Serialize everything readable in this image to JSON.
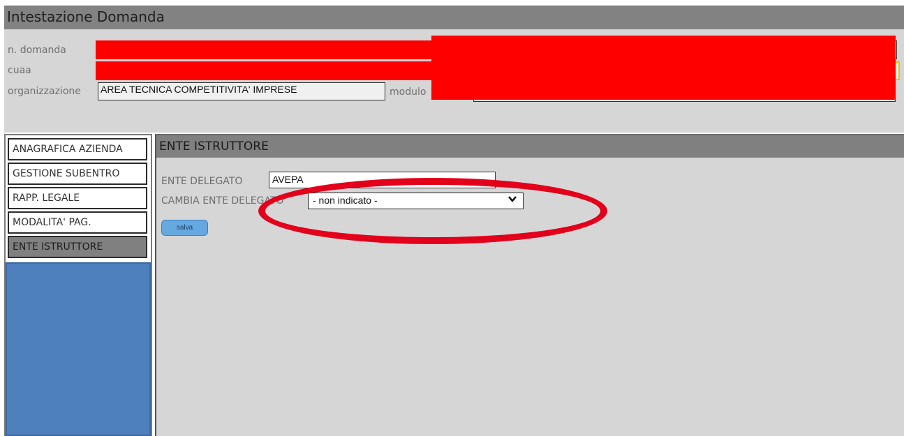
{
  "header": {
    "title": "Intestazione Domanda"
  },
  "info": {
    "n_domanda_label": "n. domanda",
    "cuaa_label": "cuaa",
    "organizzazione_label": "organizzazione",
    "organizzazione_value": "AREA TECNICA COMPETITIVITA' IMPRESE",
    "modulo_label": "modulo"
  },
  "nav": {
    "items": [
      {
        "label": "ANAGRAFICA AZIENDA"
      },
      {
        "label": "GESTIONE SUBENTRO"
      },
      {
        "label": "RAPP. LEGALE"
      },
      {
        "label": "MODALITA' PAG."
      },
      {
        "label": "ENTE ISTRUTTORE"
      }
    ],
    "active_index": 4
  },
  "main": {
    "title": "ENTE ISTRUTTORE",
    "ente_delegato_label": "ENTE DELEGATO",
    "ente_delegato_value": "AVEPA",
    "cambia_label": "CAMBIA ENTE DELEGATO",
    "select_value": "- non indicato -",
    "save_label": "salva"
  },
  "colors": {
    "header": "#828282",
    "panel": "#d6d6d6",
    "nav_fill": "#4f80be",
    "redaction": "#ff0000",
    "annotation": "#e3001b",
    "save_button": "#66a8e0"
  }
}
